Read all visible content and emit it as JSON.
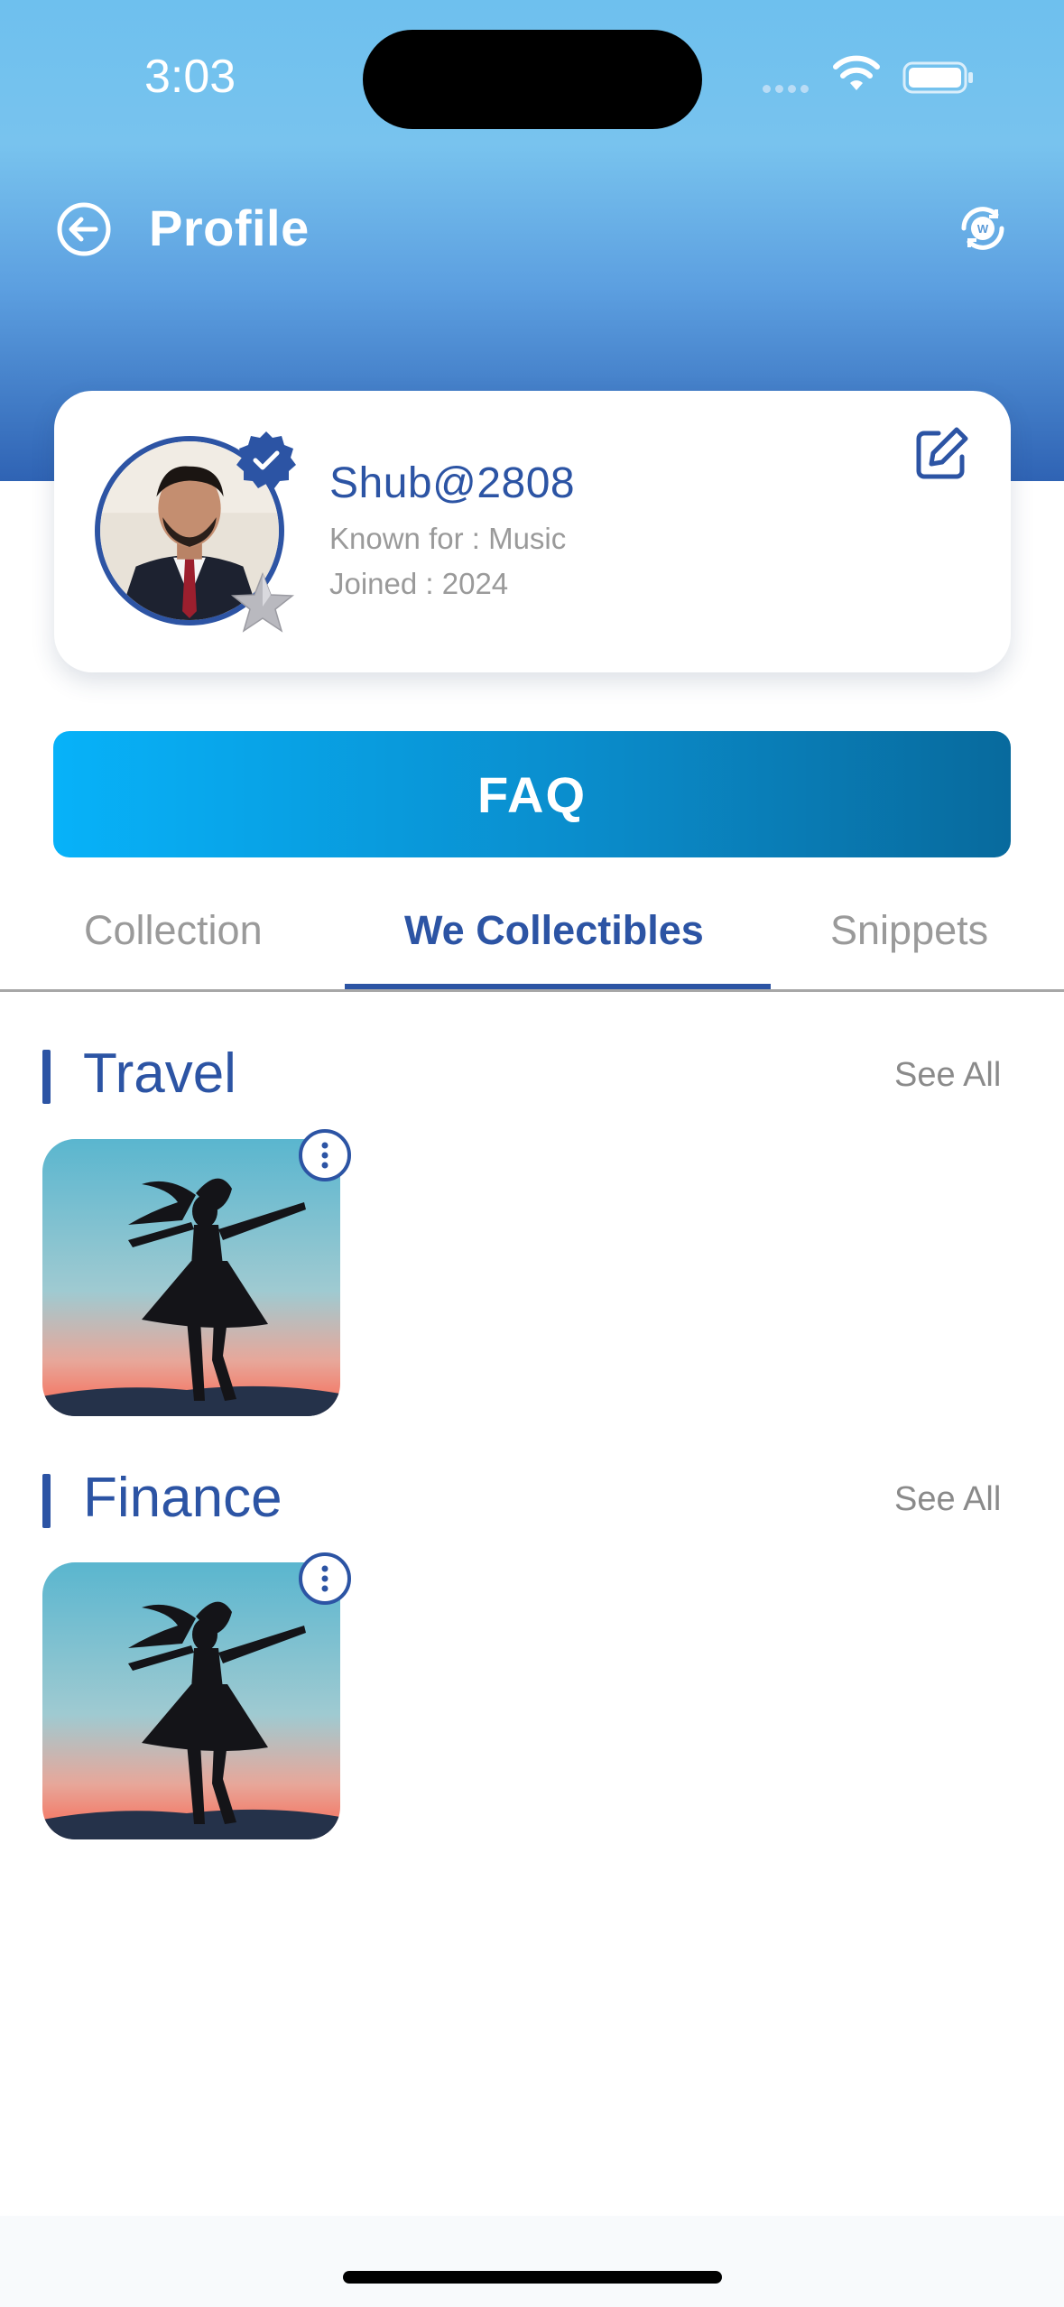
{
  "status_bar": {
    "time": "3:03"
  },
  "header": {
    "title": "Profile"
  },
  "profile": {
    "username": "Shub@2808",
    "known_for": "Known for : Music",
    "joined": "Joined : 2024"
  },
  "faq": {
    "label": "FAQ"
  },
  "tabs": [
    {
      "label": "Collection",
      "active": false
    },
    {
      "label": "We Collectibles",
      "active": true
    },
    {
      "label": "Snippets",
      "active": false
    }
  ],
  "sections": [
    {
      "title": "Travel",
      "see_all": "See All"
    },
    {
      "title": "Finance",
      "see_all": "See All"
    }
  ],
  "colors": {
    "brand_blue": "#2c54a4",
    "faq_gradient_start": "#07b2f9",
    "faq_gradient_end": "#086a9d",
    "header_top": "#6ec0ee"
  }
}
